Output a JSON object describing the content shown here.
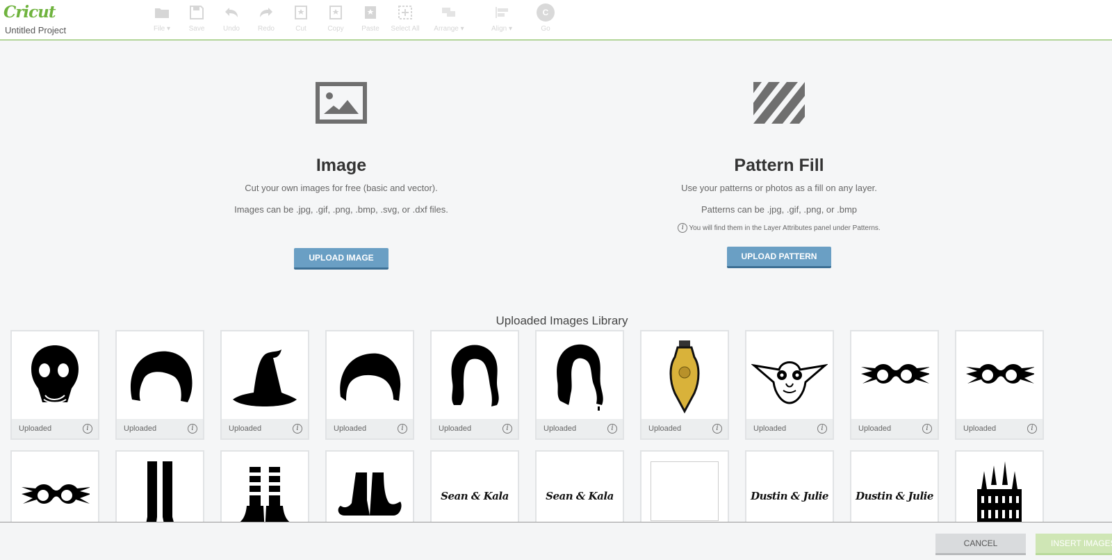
{
  "header": {
    "logo": "Cricut",
    "project_title": "Untitled Project",
    "toolbar": [
      {
        "label": "File",
        "icon": "folder-icon",
        "dropdown": true
      },
      {
        "label": "Save",
        "icon": "save-icon"
      },
      {
        "label": "Undo",
        "icon": "undo-icon"
      },
      {
        "label": "Redo",
        "icon": "redo-icon"
      },
      {
        "label": "Cut",
        "icon": "cut-icon"
      },
      {
        "label": "Copy",
        "icon": "copy-icon"
      },
      {
        "label": "Paste",
        "icon": "paste-icon"
      },
      {
        "label": "Select All",
        "icon": "select-all-icon"
      },
      {
        "label": "Arrange",
        "icon": "arrange-icon",
        "dropdown": true
      },
      {
        "label": "Align",
        "icon": "align-icon",
        "dropdown": true
      },
      {
        "label": "Go",
        "icon": "go-icon",
        "glyph": "C"
      }
    ],
    "accent_color": "#6fb33e"
  },
  "image_section": {
    "title": "Image",
    "desc": "Cut your own images for free (basic and vector).",
    "formats": "Images can be .jpg, .gif, .png, .bmp, .svg, or .dxf files.",
    "button": "UPLOAD IMAGE"
  },
  "pattern_section": {
    "title": "Pattern Fill",
    "desc": "Use your patterns or photos as a fill on any layer.",
    "formats": "Patterns can be .jpg, .gif, .png, or .bmp",
    "note": "You will find them in the Layer Attributes panel under Patterns.",
    "button": "UPLOAD PATTERN"
  },
  "library": {
    "title": "Uploaded Images Library",
    "cards": [
      {
        "image": "gas-mask",
        "status": "Uploaded"
      },
      {
        "image": "short-hair",
        "status": "Uploaded"
      },
      {
        "image": "witch-hat",
        "status": "Uploaded"
      },
      {
        "image": "bob-hair",
        "status": "Uploaded"
      },
      {
        "image": "wavy-hair",
        "status": "Uploaded"
      },
      {
        "image": "curly-hair",
        "status": "Uploaded"
      },
      {
        "image": "potion-bottle",
        "status": "Uploaded"
      },
      {
        "image": "elf-face",
        "status": "Uploaded"
      },
      {
        "image": "spectrespecs",
        "status": "Uploaded"
      },
      {
        "image": "spectrespecs",
        "status": "Uploaded"
      },
      {
        "image": "spectrespecs",
        "status": ""
      },
      {
        "image": "witch-boots",
        "status": ""
      },
      {
        "image": "striped-witch-legs",
        "status": ""
      },
      {
        "image": "elf-shoes",
        "status": ""
      },
      {
        "image": "script-text",
        "text": "Sean & Kala",
        "status": ""
      },
      {
        "image": "script-text",
        "text": "Sean & Kala",
        "status": ""
      },
      {
        "image": "broken-image",
        "status": ""
      },
      {
        "image": "script-text",
        "text": "Dustin & Julie",
        "status": ""
      },
      {
        "image": "script-text",
        "text": "Dustin & Julie",
        "status": ""
      },
      {
        "image": "temple",
        "status": ""
      }
    ]
  },
  "footer": {
    "cancel": "CANCEL",
    "insert": "INSERT IMAGES"
  }
}
